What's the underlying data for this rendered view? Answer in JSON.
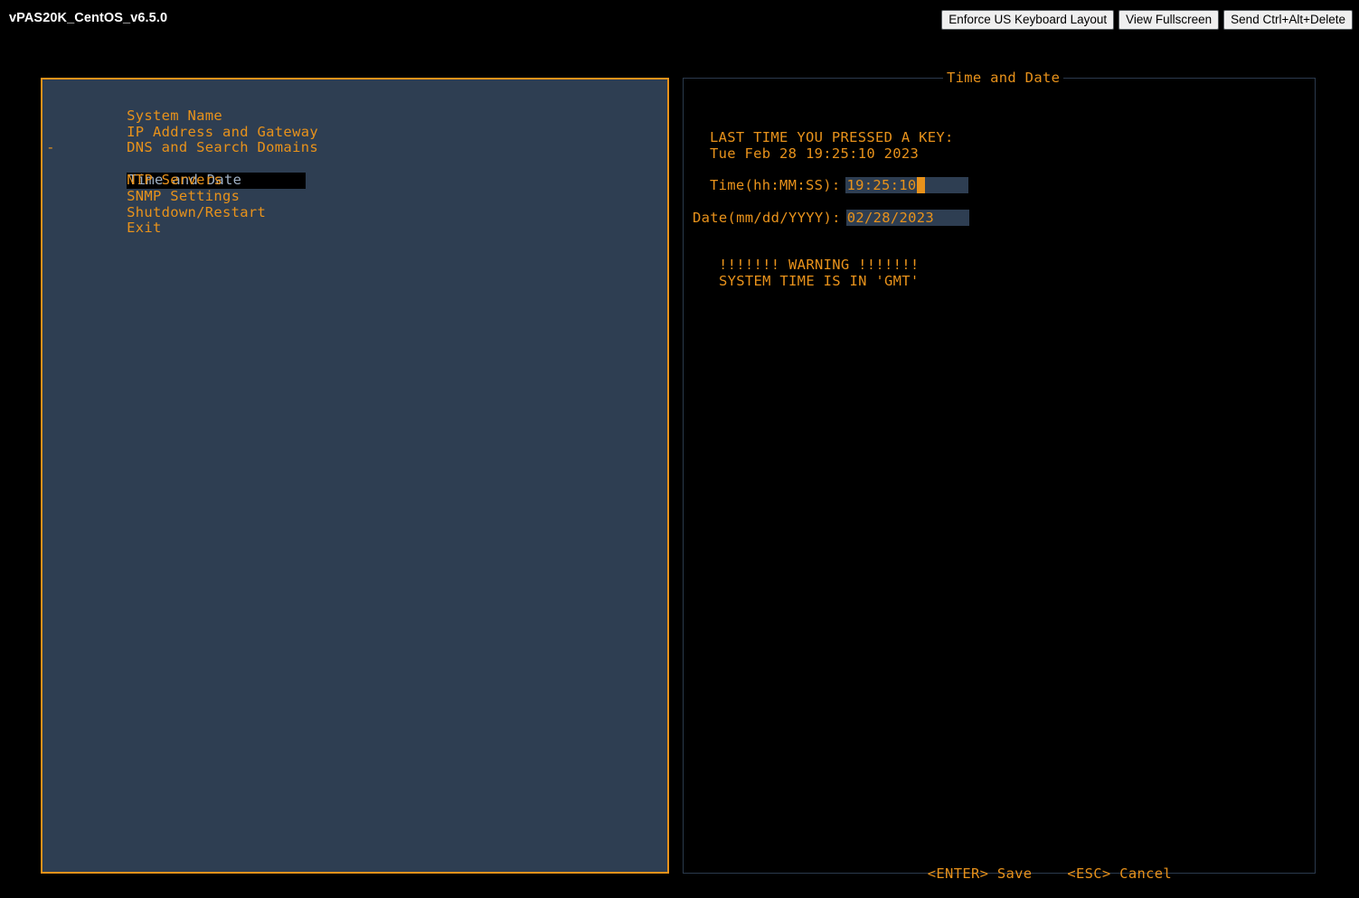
{
  "window": {
    "vm_title": "vPAS20K_CentOS_v6.5.0",
    "buttons": [
      {
        "label": "Enforce US Keyboard Layout",
        "name": "enforce-us-keyboard-layout-button"
      },
      {
        "label": "View Fullscreen",
        "name": "view-fullscreen-button"
      },
      {
        "label": "Send Ctrl+Alt+Delete",
        "name": "send-ctrl-alt-delete-button"
      }
    ]
  },
  "colors": {
    "amber": "#e8921b",
    "panel_bg": "#2e3e52",
    "screen_bg": "#000000",
    "selected_text": "#9fb0c4",
    "right_border": "#2b3a4d"
  },
  "menu": {
    "items": [
      {
        "label": "System Name",
        "selected": false
      },
      {
        "label": "IP Address and Gateway",
        "selected": false
      },
      {
        "label": "DNS and Search Domains",
        "selected": false
      },
      {
        "label": "Time and Date",
        "selected": true
      },
      {
        "label": "NTP Servers",
        "selected": false
      },
      {
        "label": "SNMP Settings",
        "selected": false
      },
      {
        "label": "Shutdown/Restart",
        "selected": false
      },
      {
        "label": "Exit",
        "selected": false
      }
    ],
    "selection_marker": "-"
  },
  "detail": {
    "title": "Time and Date",
    "last_key_label": "LAST TIME YOU PRESSED A KEY:",
    "last_key_value": "Tue Feb 28 19:25:10 2023",
    "time_field": {
      "label": "Time(hh:MM:SS):",
      "value": "19:25:10",
      "has_cursor": true
    },
    "date_field": {
      "label": "Date(mm/dd/YYYY):",
      "value": "02/28/2023",
      "has_cursor": false
    },
    "warning_line_1": "!!!!!!! WARNING !!!!!!!",
    "warning_line_2": "SYSTEM TIME IS IN 'GMT'",
    "footer": {
      "save": "<ENTER> Save",
      "cancel": "<ESC> Cancel"
    }
  }
}
